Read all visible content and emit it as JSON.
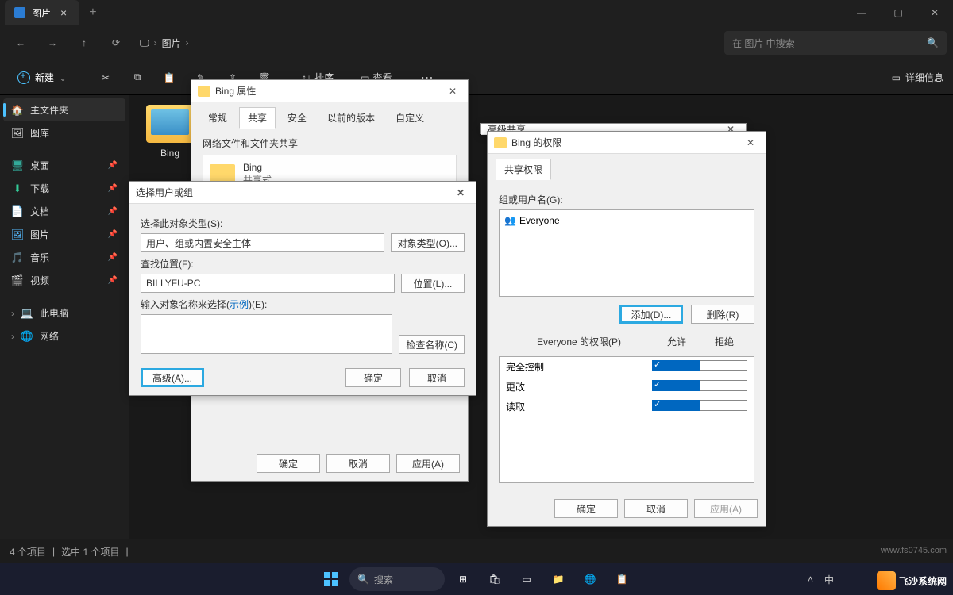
{
  "titlebar": {
    "tab_title": "图片",
    "tab_close": "×",
    "new_tab": "+"
  },
  "nav": {
    "crumb_root": "图片",
    "search_placeholder": "在 图片 中搜索"
  },
  "toolbar": {
    "new_label": "新建",
    "sort_label": "排序",
    "view_label": "查看",
    "details_label": "详细信息"
  },
  "sidebar": {
    "home": "主文件夹",
    "gallery": "图库",
    "desktop": "桌面",
    "downloads": "下载",
    "documents": "文档",
    "pictures": "图片",
    "music": "音乐",
    "videos": "视频",
    "thispc": "此电脑",
    "network": "网络"
  },
  "content": {
    "folder_name": "Bing"
  },
  "status": {
    "items": "4 个项目",
    "selected": "选中 1 个项目"
  },
  "taskbar": {
    "search": "搜索",
    "lang": "中"
  },
  "props_dialog": {
    "title": "Bing 属性",
    "tabs": {
      "general": "常规",
      "share": "共享",
      "security": "安全",
      "prev": "以前的版本",
      "custom": "自定义"
    },
    "section_title": "网络文件和文件夹共享",
    "folder_name": "Bing",
    "share_status": "共享式",
    "ok": "确定",
    "cancel": "取消",
    "apply": "应用(A)"
  },
  "select_dialog": {
    "title": "选择用户或组",
    "obj_type_label": "选择此对象类型(S):",
    "obj_type_value": "用户、组或内置安全主体",
    "obj_type_btn": "对象类型(O)...",
    "location_label": "查找位置(F):",
    "location_value": "BILLYFU-PC",
    "location_btn": "位置(L)...",
    "name_label": "输入对象名称来选择(",
    "name_example": "示例",
    "name_label2": ")(E):",
    "check_btn": "检查名称(C)",
    "advanced_btn": "高级(A)...",
    "ok": "确定",
    "cancel": "取消"
  },
  "adv_share": {
    "title": "高级共享"
  },
  "perm_dialog": {
    "title": "Bing 的权限",
    "tab": "共享权限",
    "group_label": "组或用户名(G):",
    "user": "Everyone",
    "add_btn": "添加(D)...",
    "remove_btn": "删除(R)",
    "perm_for": "Everyone 的权限(P)",
    "allow": "允许",
    "deny": "拒绝",
    "rows": {
      "full": "完全控制",
      "change": "更改",
      "read": "读取"
    },
    "ok": "确定",
    "cancel": "取消",
    "apply": "应用(A)"
  },
  "watermark": {
    "url": "www.fs0745.com",
    "brand": "飞沙系统网"
  }
}
